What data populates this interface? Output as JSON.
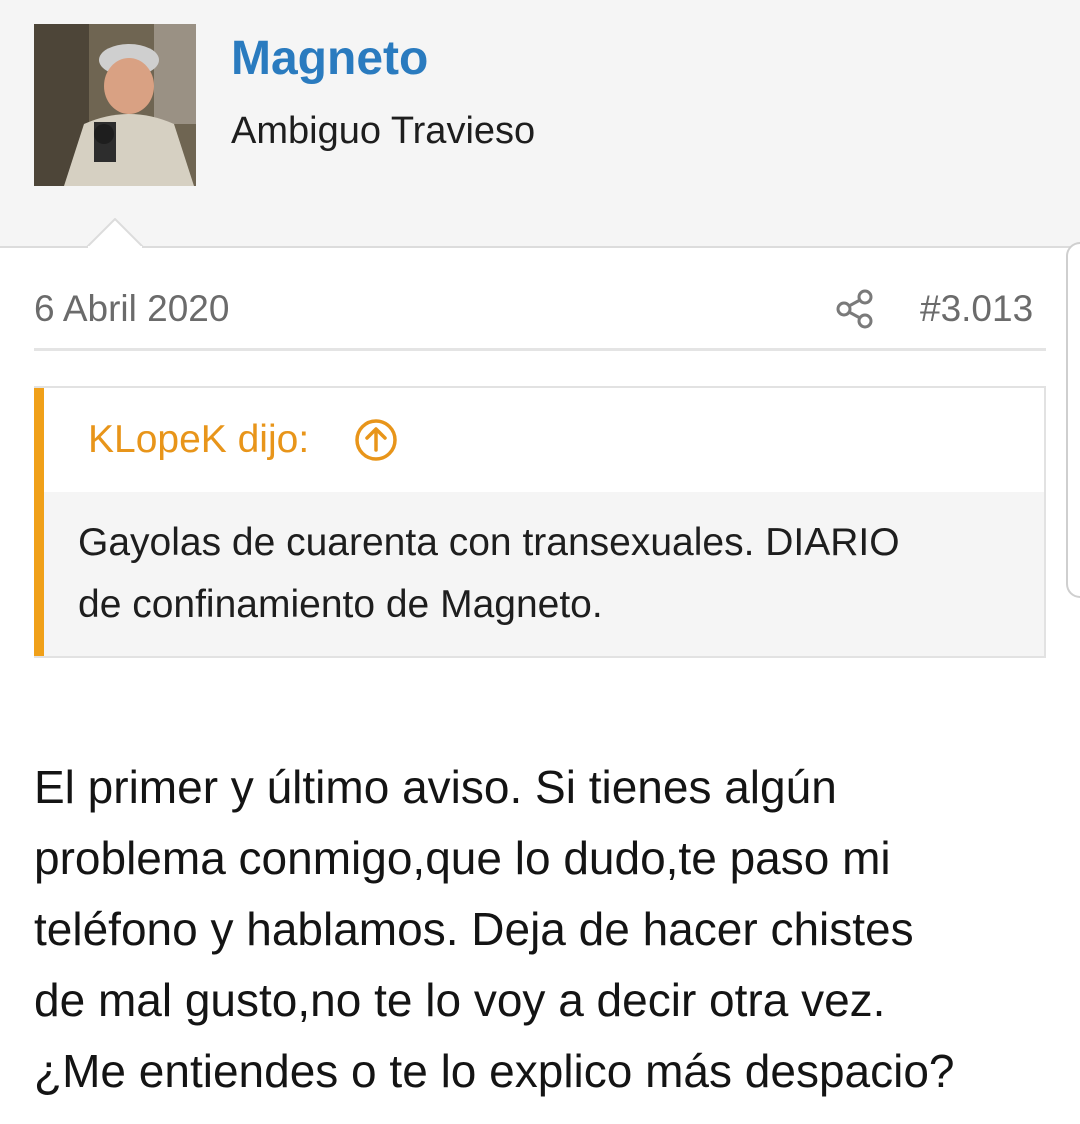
{
  "author": {
    "username": "Magneto",
    "title": "Ambiguo Travieso",
    "avatar_icon": "user-avatar-photo"
  },
  "post": {
    "date": "6 Abril 2020",
    "number": "#3.013",
    "share_icon": "share-icon"
  },
  "quote": {
    "author": "KLopeK dijo:",
    "jump_icon": "arrow-up-circle-icon",
    "lines": [
      "Gayolas de cuarenta con transexuales. DIARIO",
      "de confinamiento de Magneto."
    ]
  },
  "body": {
    "lines": [
      "El primer y último aviso. Si tienes algún",
      "problema conmigo,que lo dudo,te paso mi",
      "teléfono y hablamos. Deja de hacer chistes",
      "de mal gusto,no te lo voy a decir otra vez.",
      "¿Me entiendes o te lo explico más despacio?"
    ]
  },
  "colors": {
    "username": "#2a7bbf",
    "quote_accent": "#f0a019",
    "quote_author": "#e8951a",
    "meta_text": "#6b6b6b"
  }
}
